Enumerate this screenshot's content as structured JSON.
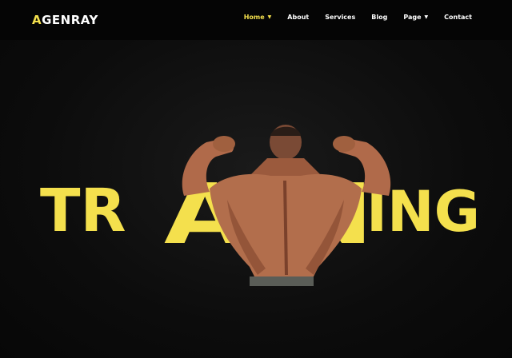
{
  "brand": {
    "first_letter": "A",
    "rest": "GENRAY"
  },
  "nav": {
    "items": [
      {
        "label": "Home",
        "caret": "▼",
        "active": true
      },
      {
        "label": "About"
      },
      {
        "label": "Services"
      },
      {
        "label": "Blog"
      },
      {
        "label": "Page",
        "caret": "▼"
      },
      {
        "label": "Contact"
      }
    ]
  },
  "hero": {
    "word_left": "TR",
    "word_mid": "AIN",
    "word_right": "ING",
    "accent_color": "#f4e04d"
  }
}
